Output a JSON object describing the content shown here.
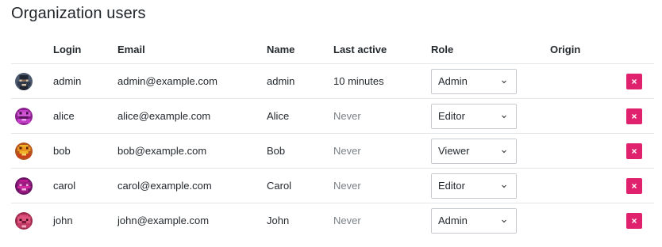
{
  "page": {
    "title": "Organization users"
  },
  "table": {
    "columns": [
      "",
      "Login",
      "Email",
      "Name",
      "Last active",
      "Role",
      "Origin",
      ""
    ],
    "rows": [
      {
        "login": "admin",
        "email": "admin@example.com",
        "name": "admin",
        "last_active": "10 minutes",
        "role": "Admin",
        "origin": "",
        "avatar_icon": "admin-avatar-icon"
      },
      {
        "login": "alice",
        "email": "alice@example.com",
        "name": "Alice",
        "last_active": "Never",
        "role": "Editor",
        "origin": "",
        "avatar_icon": "alice-avatar-icon"
      },
      {
        "login": "bob",
        "email": "bob@example.com",
        "name": "Bob",
        "last_active": "Never",
        "role": "Viewer",
        "origin": "",
        "avatar_icon": "bob-avatar-icon"
      },
      {
        "login": "carol",
        "email": "carol@example.com",
        "name": "Carol",
        "last_active": "Never",
        "role": "Editor",
        "origin": "",
        "avatar_icon": "carol-avatar-icon"
      },
      {
        "login": "john",
        "email": "john@example.com",
        "name": "John",
        "last_active": "Never",
        "role": "Admin",
        "origin": "",
        "avatar_icon": "john-avatar-icon"
      }
    ]
  },
  "colors": {
    "remove_button": "#e0226e",
    "muted_text": "#7b8087",
    "border": "#e4e7ea"
  }
}
